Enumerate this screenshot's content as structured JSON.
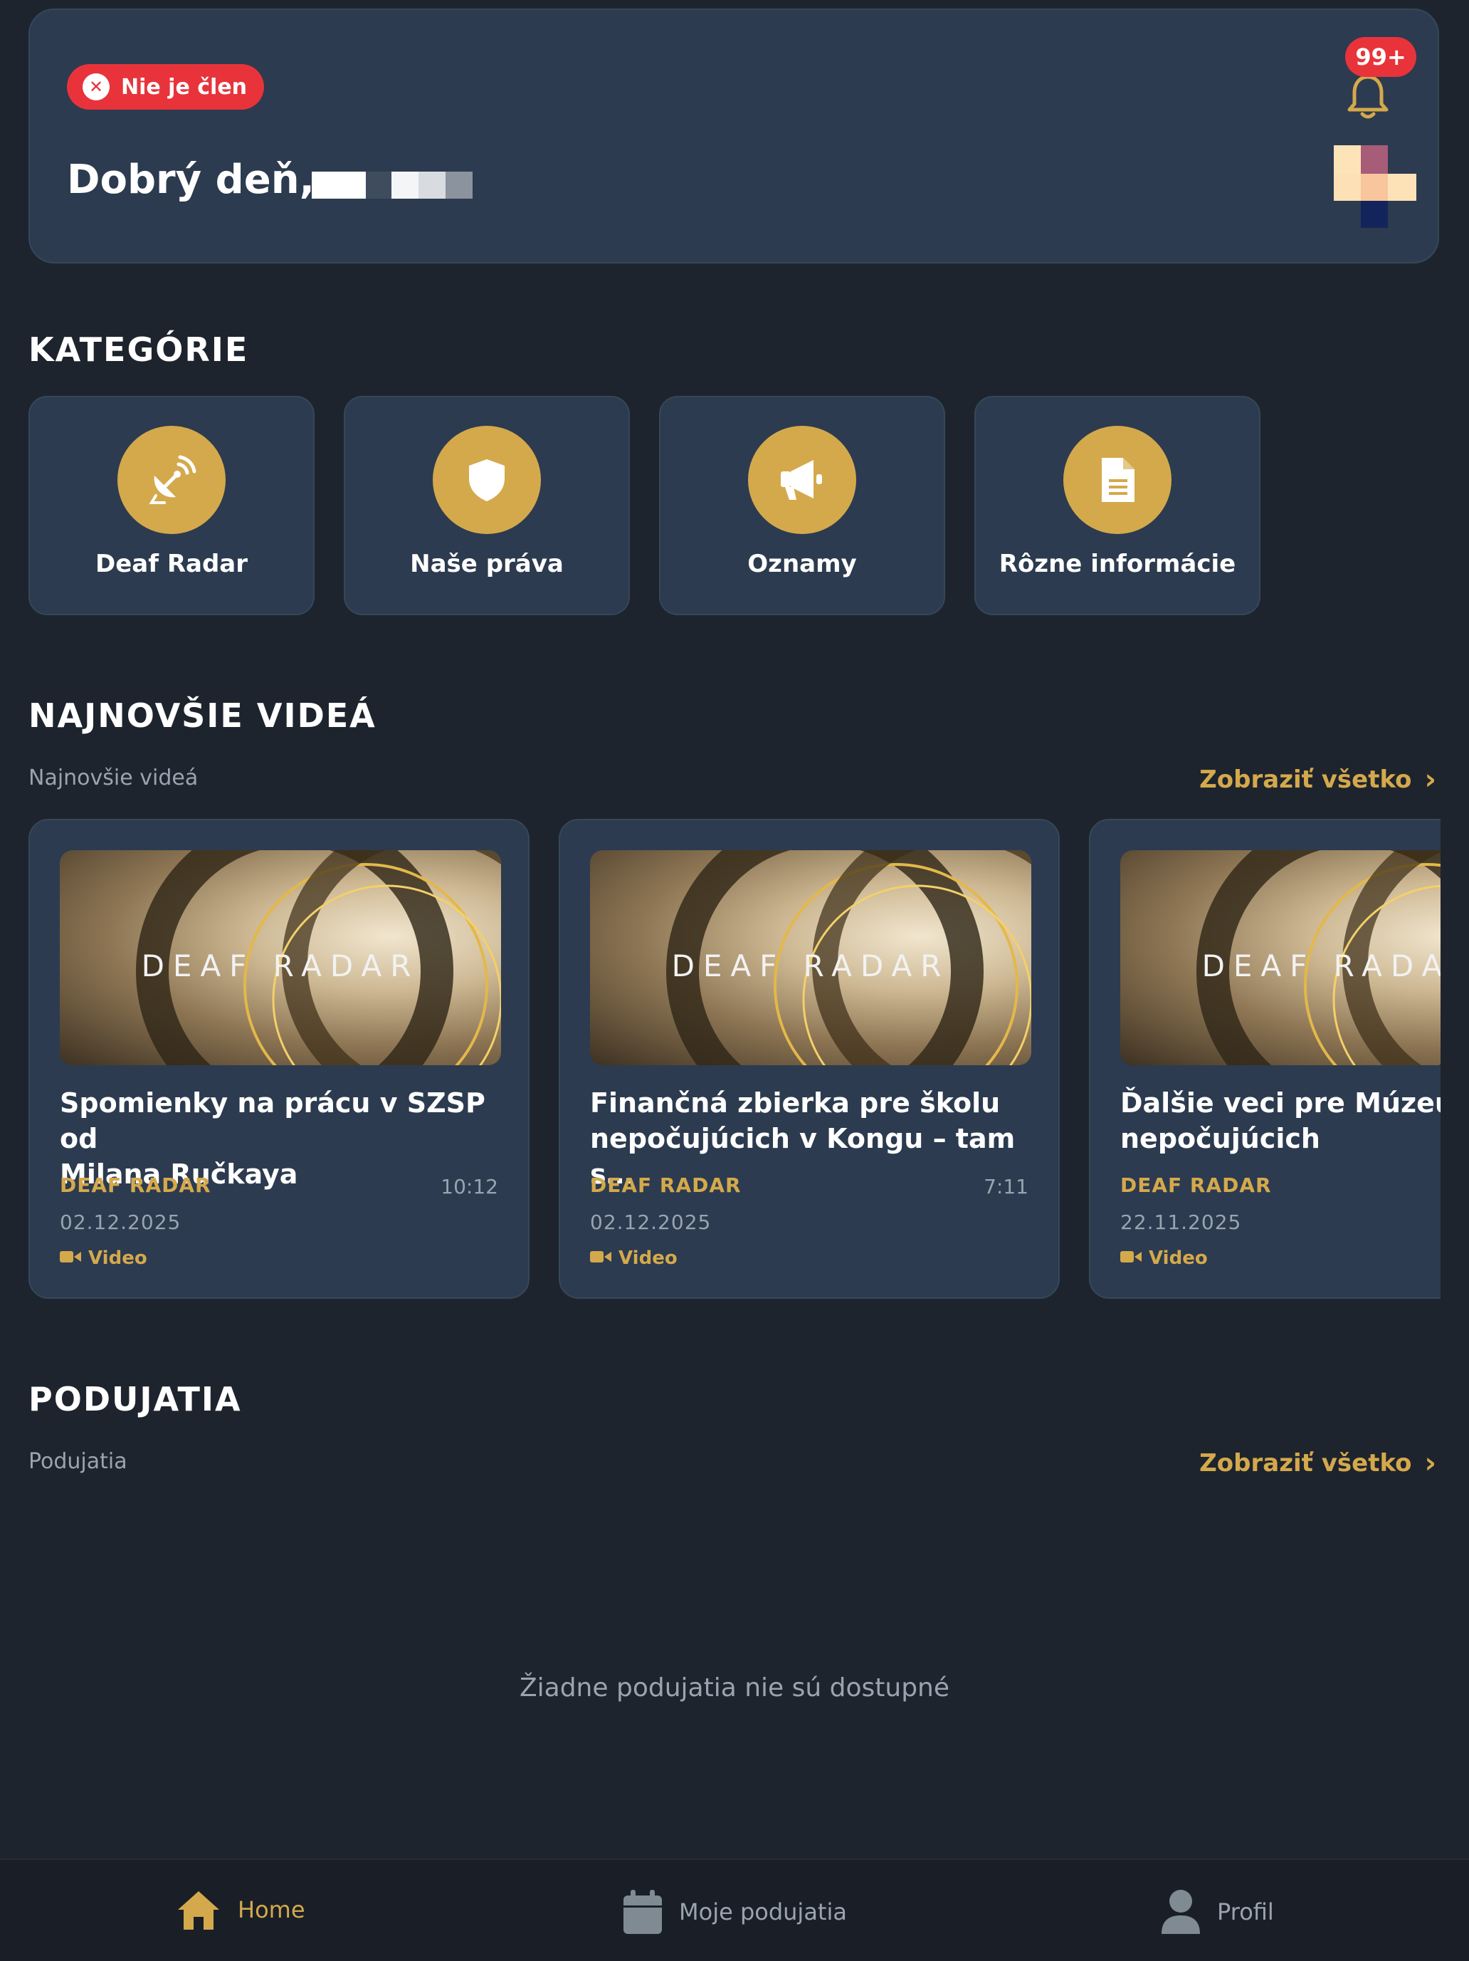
{
  "header": {
    "membership_badge": "Nie je člen",
    "greeting": "Dobrý deň,",
    "notification_count": "99+"
  },
  "categories": {
    "title": "KATEGÓRIE",
    "items": [
      {
        "label": "Deaf Radar",
        "icon": "satellite-dish-icon"
      },
      {
        "label": "Naše práva",
        "icon": "shield-icon"
      },
      {
        "label": "Oznamy",
        "icon": "megaphone-icon"
      },
      {
        "label": "Rôzne informácie",
        "icon": "document-icon"
      }
    ]
  },
  "videos": {
    "title": "NAJNOVŠIE VIDEÁ",
    "subtitle": "Najnovšie videá",
    "see_all": "Zobraziť všetko",
    "thumbnail_text": "DEAF RADAR",
    "items": [
      {
        "title": "Spomienky na prácu v SZSP od\nMilana Ručkaya",
        "channel": "DEAF RADAR",
        "duration": "10:12",
        "date": "02.12.2025",
        "type": "Video"
      },
      {
        "title": "Finančná zbierka pre školu\nnepočujúcich v Kongu – tam s…",
        "channel": "DEAF RADAR",
        "duration": "7:11",
        "date": "02.12.2025",
        "type": "Video"
      },
      {
        "title": "Ďalšie veci pre Múzeum\nnepočujúcich",
        "channel": "DEAF RADAR",
        "duration": "",
        "date": "22.11.2025",
        "type": "Video"
      }
    ]
  },
  "events": {
    "title": "PODUJATIA",
    "subtitle": "Podujatia",
    "see_all": "Zobraziť všetko",
    "empty_message": "Žiadne podujatia nie sú dostupné"
  },
  "bottom_nav": {
    "items": [
      {
        "label": "Home",
        "icon": "home-icon",
        "active": true
      },
      {
        "label": "Moje podujatia",
        "icon": "calendar-icon",
        "active": false
      },
      {
        "label": "Profil",
        "icon": "person-icon",
        "active": false
      }
    ]
  },
  "colors": {
    "accent": "#d4a94c",
    "danger": "#e8333b",
    "background": "#1e242d",
    "card": "#2c3b4f"
  }
}
